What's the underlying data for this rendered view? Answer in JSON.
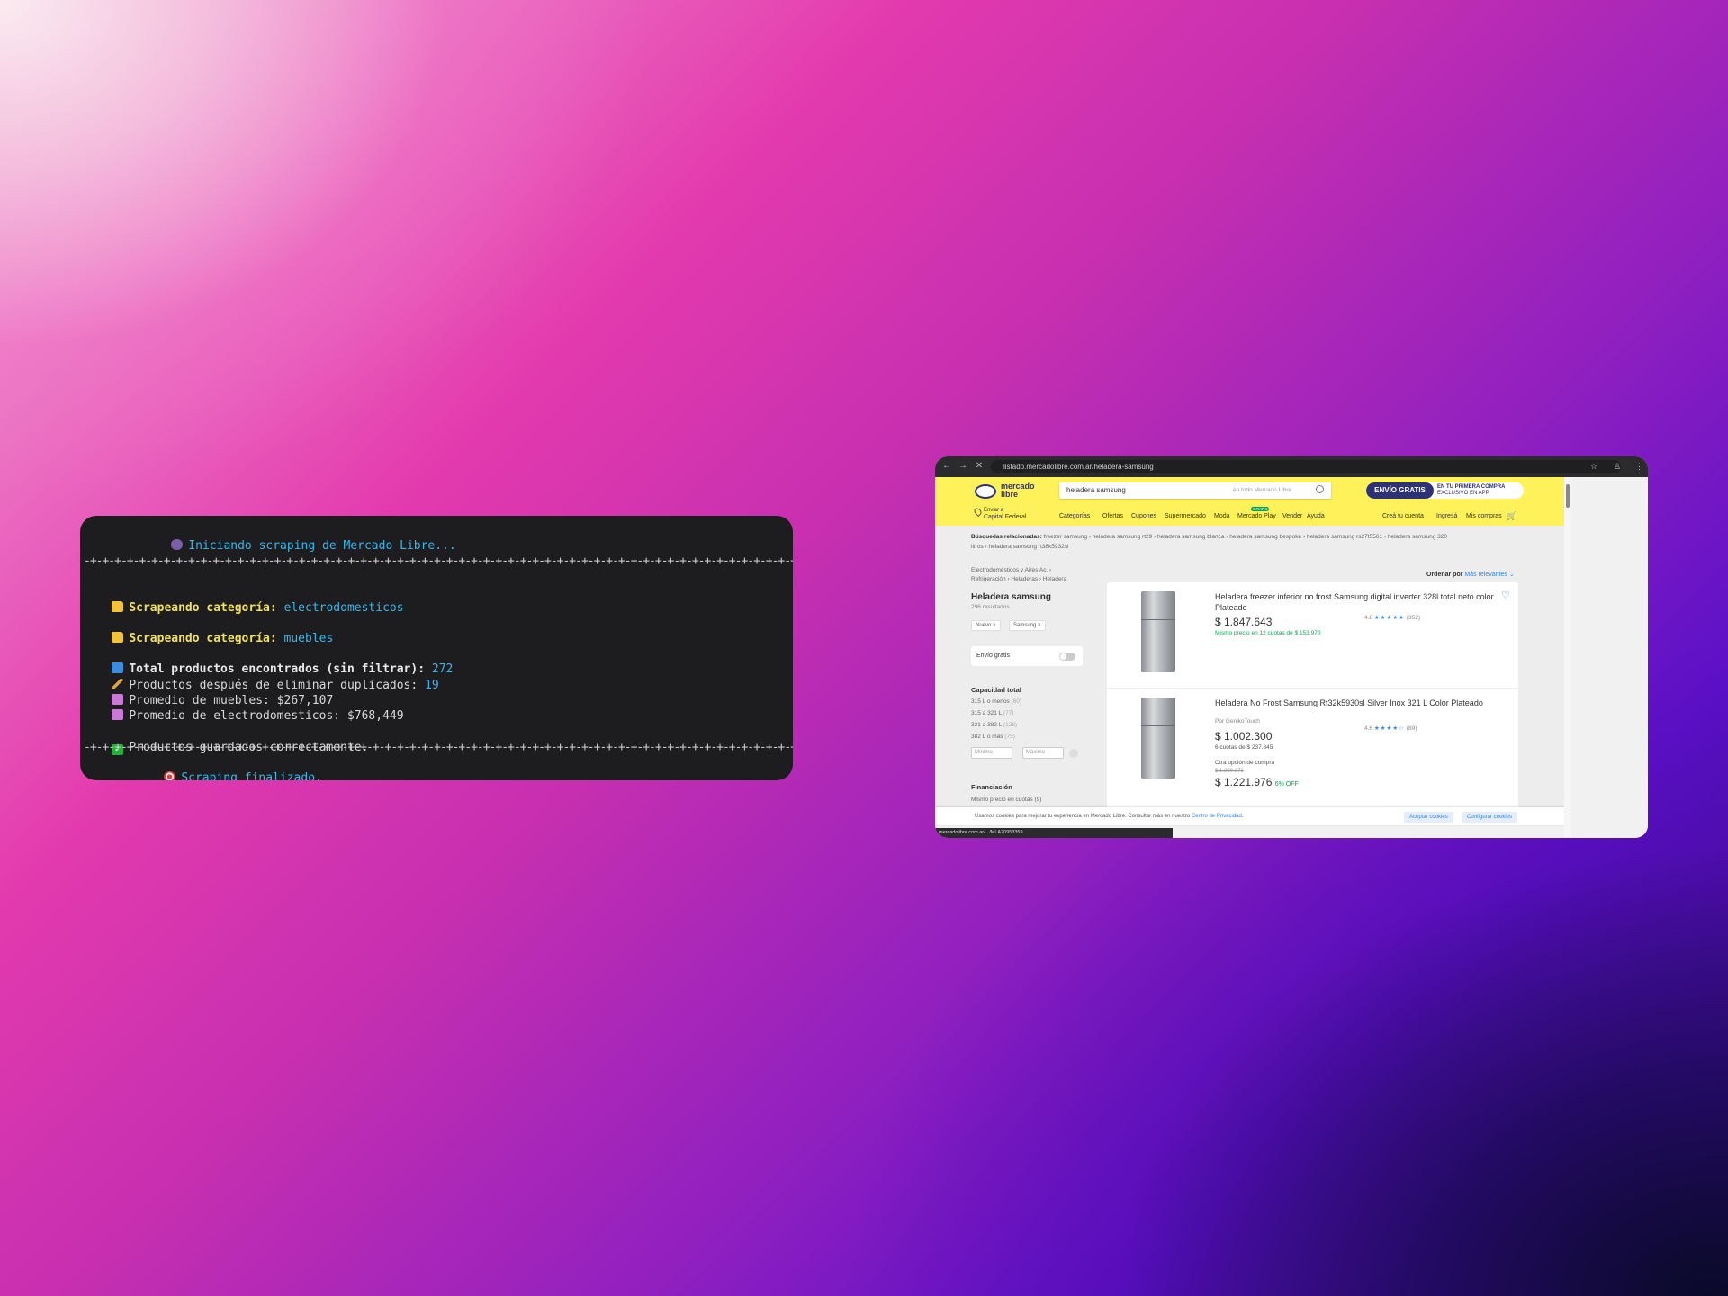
{
  "terminal": {
    "lines": {
      "start": "Iniciando scraping de Mercado Libre...",
      "sep": "-+-+-+-+-+-+-+-+-+-+-+-+-+-+-+-+-+-+-+-+-+-+-+-+-+-+-+-+-+-+-+-+-+-+-+-+-+-+-+-+-+-+-+-+-+-+-+-+-+-+-+-+-+-+-+-+-+-+-+-+-+-+-+-+-+-+-+-+-+-+-+-+-+-+-",
      "cat_label": "Scrapeando categoría:",
      "cat1": "electrodomesticos",
      "cat2": "muebles",
      "total_label": "Total productos encontrados (sin filtrar):",
      "total_value": "272",
      "dedup_label": "Productos después de eliminar duplicados:",
      "dedup_value": "19",
      "avg_muebles": "Promedio de muebles: $267,107",
      "avg_electro": "Promedio de electrodomesticos: $768,449",
      "saved": "Productos guardados correctamente.",
      "end": "Scraping finalizado."
    }
  },
  "browser": {
    "url": "listado.mercadolibre.com.ar/heladera-samsung",
    "logo": "mercado libre",
    "search_value": "heladera samsung",
    "search_scope": "en todo Mercado Libre",
    "promo_left": "ENVÍO GRATIS",
    "promo_right_1": "EN TU PRIMERA COMPRA",
    "promo_right_2": "EXCLUSIVO EN APP",
    "location_1": "Enviar a",
    "location_2": "Capital Federal",
    "nav": [
      "Categorías",
      "Ofertas",
      "Cupones",
      "Supermercado",
      "Moda",
      "Mercado Play",
      "Vender",
      "Ayuda"
    ],
    "nav_badge": "GRATIS",
    "nav_right": [
      "Creá tu cuenta",
      "Ingresá",
      "Mis compras"
    ],
    "related_label": "Búsquedas relacionadas:",
    "related_1": "freezer samsung  ›  heladera samsung rt29  ›  heladera samsung blanca  ›  heladera samsung bespoke  ›  heladera samsung rs27t5561  ›  heladera samsung 320",
    "related_2": "litros  ›  heladera samsung rt38k5932sl",
    "crumb_1": "Electrodomésticos y Aires Ac.  ›",
    "crumb_2": "Refrigeración  ›  Heladeras  ›  Heladera",
    "title": "Heladera samsung",
    "count": "296 resultados",
    "chips": [
      "Nuevo ×",
      "Samsung ×"
    ],
    "free_shipping": "Envío gratis",
    "capacity_title": "Capacidad total",
    "capacity_options": [
      {
        "label": "315 L o menos",
        "count": "(60)"
      },
      {
        "label": "315 a 321 L",
        "count": "(77)"
      },
      {
        "label": "321 a 382 L",
        "count": "(126)"
      },
      {
        "label": "382 L o más",
        "count": "(75)"
      }
    ],
    "min_placeholder": "Mínimo",
    "max_placeholder": "Máximo",
    "finance_title": "Financiación",
    "finance_option": "Mismo precio en cuotas (9)",
    "sort_label": "Ordenar por",
    "sort_value": "Más relevantes ⌄",
    "products": [
      {
        "title": "Heladera freezer inferior no frost Samsung digital inverter 328l total neto color Plateado",
        "price": "$ 1.847.643",
        "sub": "Mismo precio en 12 cuotas de $ 153.970",
        "rating": "4.8",
        "reviews": "(352)"
      },
      {
        "title": "Heladera No Frost Samsung Rt32k5930sl Silver Inox 321 L Color Plateado",
        "seller": "Por GenikoTouch",
        "price": "$ 1.002.300",
        "sub": "6 cuotas de $ 237.845",
        "rating": "4.6",
        "reviews": "(89)",
        "other_label": "Otra opción de compra",
        "old_price": "$ 1.299.876",
        "other_price": "$ 1.221.976",
        "discount": "6% OFF"
      }
    ],
    "cookie_text": "Usamos cookies para mejorar tu experiencia en Mercado Libre. Consultar más en nuestro",
    "cookie_link": "Centro de Privacidad",
    "cookie_accept": "Aceptar cookies",
    "cookie_config": "Configurar cookies",
    "status_url": "mercadolibre.com.ar/.../MLA20953359"
  }
}
